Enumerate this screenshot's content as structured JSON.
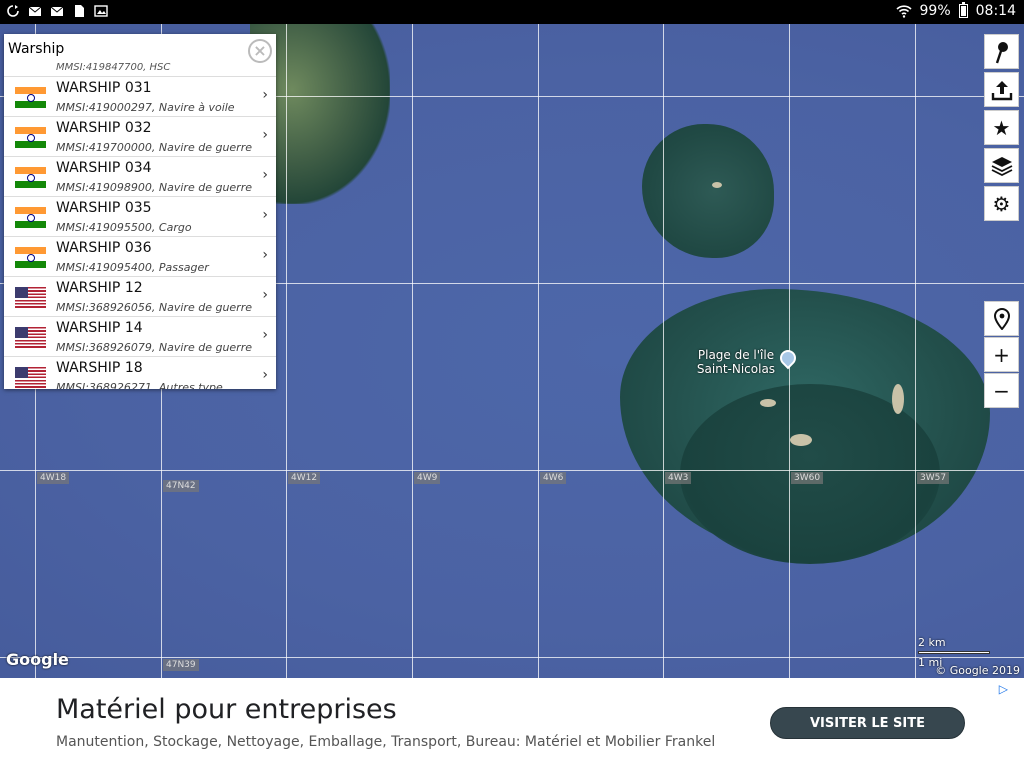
{
  "status_bar": {
    "battery": "99%",
    "time": "08:14",
    "left_icons": [
      "sync-icon",
      "mail-icon",
      "mail-icon",
      "sim-icon",
      "image-icon"
    ]
  },
  "search": {
    "value": "Warship",
    "partial_row_sub": "MMSI:419847700, HSC"
  },
  "results": [
    {
      "flag": "india",
      "name": "WARSHIP 031",
      "sub": "MMSI:419000297, Navire à voile"
    },
    {
      "flag": "india",
      "name": "WARSHIP 032",
      "sub": "MMSI:419700000, Navire de guerre"
    },
    {
      "flag": "india",
      "name": "WARSHIP 034",
      "sub": "MMSI:419098900, Navire de guerre"
    },
    {
      "flag": "india",
      "name": "WARSHIP 035",
      "sub": "MMSI:419095500, Cargo"
    },
    {
      "flag": "india",
      "name": "WARSHIP 036",
      "sub": "MMSI:419095400, Passager"
    },
    {
      "flag": "usa",
      "name": "WARSHIP 12",
      "sub": "MMSI:368926056, Navire de guerre"
    },
    {
      "flag": "usa",
      "name": "WARSHIP 14",
      "sub": "MMSI:368926079, Navire de guerre"
    },
    {
      "flag": "usa",
      "name": "WARSHIP 18",
      "sub": "MMSI:368926271, Autres type"
    }
  ],
  "map": {
    "poi_label_line1": "Plage de l'île",
    "poi_label_line2": "Saint-Nicolas",
    "grid_labels": [
      "4W18",
      "47N42",
      "4W12",
      "4W9",
      "4W6",
      "4W3",
      "3W60",
      "3W57",
      "47N39"
    ],
    "google_logo": "Google",
    "scale_km": "2 km",
    "scale_mi": "1 mi",
    "copyright": "© Google 2019"
  },
  "toolbar": {
    "buttons": [
      "pin-icon",
      "share-icon",
      "star-icon",
      "layers-icon",
      "gear-icon"
    ],
    "zoom": [
      "locate-icon",
      "+",
      "−"
    ]
  },
  "ad": {
    "title": "Matériel pour entreprises",
    "text": "Manutention, Stockage, Nettoyage, Emballage, Transport, Bureau: Matériel et Mobilier Frankel",
    "button": "VISITER LE SITE"
  }
}
